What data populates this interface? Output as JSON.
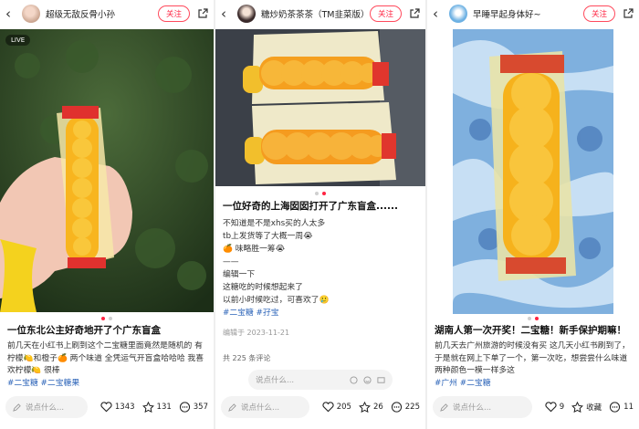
{
  "colors": {
    "accent": "#ff2442",
    "tag": "#2b63b8"
  },
  "panels": [
    {
      "author": "超级无敌反骨小孙",
      "follow_label": "关注",
      "live_label": "LIVE",
      "title": "一位东北公主好奇地开了个广东盲盒",
      "body": "前几天在小红书上刷到这个二宝糖里面竟然是随机的 有柠檬🍋和橙子🍊 两个味道 全凭运气开盲盒哈哈哈 我喜欢柠檬🍋 很棒",
      "tags": "#二宝糖  #二宝糖果",
      "comment_placeholder": "说点什么...",
      "likes": "1343",
      "stars": "131",
      "comments": "357"
    },
    {
      "author": "糖炒奶茶茶茶（TM韭菜版）",
      "follow_label": "关注",
      "title": "一位好奇的上海囡囡打开了广东盲盒......",
      "lines": [
        "不知道是不是xhs买的人太多",
        "tb上发货等了大概一周😭",
        "🍊 味略胜一筹😭",
        "——",
        "编辑一下",
        "这糖吃的时候想起来了",
        "以前小时候吃过，可喜欢了🥲"
      ],
      "tags": "#二宝糖  #孖宝",
      "date": "编辑于 2023-11-21",
      "comment_count_label": "共 225 条评论",
      "comment_placeholder": "说点什么...",
      "likes": "205",
      "stars": "26",
      "comments": "225"
    },
    {
      "author": "早睡早起身体好~",
      "follow_label": "关注",
      "title": "湖南人第一次开奖！二宝糖！新手保护期嘛！",
      "body": "前几天去广州旅游的时候没有买 这几天小红书刷到了，于是就在网上下单了一个，第一次吃，想尝尝什么味道 两种颜色一模一样多这",
      "tags": "#广州  #二宝糖",
      "comment_placeholder": "说点什么...",
      "likes": "9",
      "stars_label": "收藏",
      "comments": "11"
    }
  ]
}
